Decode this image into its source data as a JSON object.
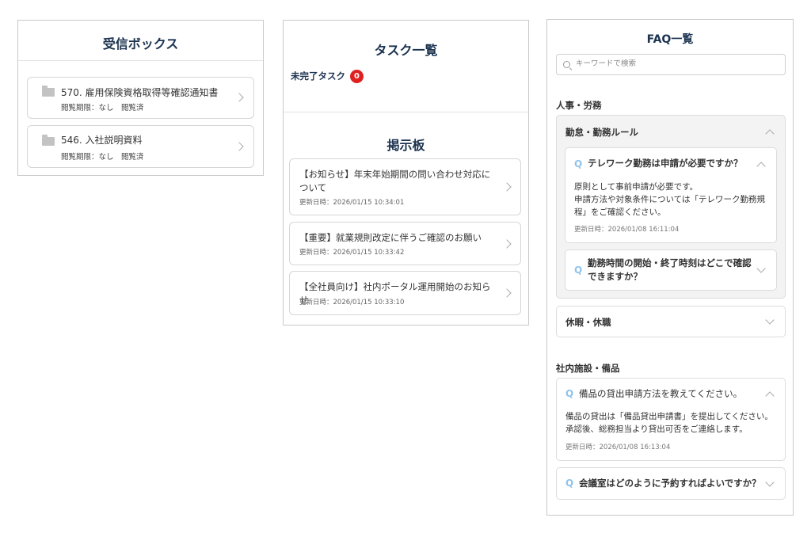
{
  "inbox": {
    "title": "受信ボックス",
    "items": [
      {
        "name": "570. 雇用保険資格取得等確認通知書",
        "meta": "閲覧期限：なし　閲覧済"
      },
      {
        "name": "546. 入社説明資料",
        "meta": "閲覧期限：なし　閲覧済"
      }
    ]
  },
  "tasks": {
    "title": "タスク一覧",
    "pending_label": "未完了タスク",
    "pending_count": "0",
    "board_title": "掲示板",
    "notices": [
      {
        "title": "【お知らせ】年末年始期間の問い合わせ対応について",
        "date": "更新日時：2026/01/15 10:34:01"
      },
      {
        "title": "【重要】就業規則改定に伴うご確認のお願い",
        "date": "更新日時：2026/01/15 10:33:42"
      },
      {
        "title": "【全社員向け】社内ポータル運用開始のお知らせ",
        "date": "更新日時：2026/01/15 10:33:10"
      }
    ]
  },
  "faq": {
    "title": "FAQ一覧",
    "search_placeholder": "キーワードで検索",
    "q_mark": "Q",
    "sections": [
      {
        "title": "人事・労務",
        "categories": [
          {
            "title": "勤怠・勤務ルール",
            "questions": [
              {
                "q": "テレワーク勤務は申請が必要ですか？",
                "answer": "原則として事前申請が必要です。\n申請方法や対象条件については「テレワーク勤務規程」をご確認ください。",
                "date": "更新日時：2026/01/08 16:11:04"
              },
              {
                "q": "勤務時間の開始・終了時刻はどこで確認できますか？"
              }
            ]
          },
          {
            "title": "休暇・休職"
          }
        ]
      },
      {
        "title": "社内施設・備品",
        "questions": [
          {
            "q": "備品の貸出申請方法を教えてください。",
            "answer": "備品の貸出は「備品貸出申請書」を提出してください。\n承認後、総務担当より貸出可否をご連絡します。",
            "date": "更新日時：2026/01/08 16:13:04"
          },
          {
            "q": "会議室はどのように予約すればよいですか？"
          }
        ]
      }
    ]
  }
}
